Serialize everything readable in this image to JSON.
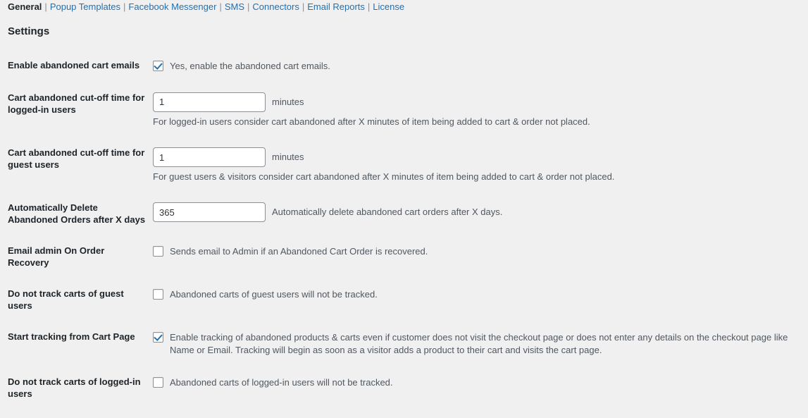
{
  "tabs": {
    "separator": "|",
    "items": [
      {
        "label": "General",
        "current": true
      },
      {
        "label": "Popup Templates",
        "current": false
      },
      {
        "label": "Facebook Messenger",
        "current": false
      },
      {
        "label": "SMS",
        "current": false
      },
      {
        "label": "Connectors",
        "current": false
      },
      {
        "label": "Email Reports",
        "current": false
      },
      {
        "label": "License",
        "current": false
      }
    ]
  },
  "heading": "Settings",
  "rows": [
    {
      "label": "Enable abandoned cart emails",
      "type": "checkbox",
      "checked": true,
      "checkbox_label": "Yes, enable the abandoned cart emails."
    },
    {
      "label": "Cart abandoned cut-off time for logged-in users",
      "type": "input",
      "value": "1",
      "unit": "minutes",
      "description": "For logged-in users consider cart abandoned after X minutes of item being added to cart & order not placed."
    },
    {
      "label": "Cart abandoned cut-off time for guest users",
      "type": "input",
      "value": "1",
      "unit": "minutes",
      "description": "For guest users & visitors consider cart abandoned after X minutes of item being added to cart & order not placed."
    },
    {
      "label": "Automatically Delete Abandoned Orders after X days",
      "type": "input-inline",
      "value": "365",
      "inline_description": "Automatically delete abandoned cart orders after X days."
    },
    {
      "label": "Email admin On Order Recovery",
      "type": "checkbox",
      "checked": false,
      "checkbox_label": "Sends email to Admin if an Abandoned Cart Order is recovered."
    },
    {
      "label": "Do not track carts of guest users",
      "type": "checkbox",
      "checked": false,
      "checkbox_label": "Abandoned carts of guest users will not be tracked."
    },
    {
      "label": "Start tracking from Cart Page",
      "type": "checkbox",
      "checked": true,
      "checkbox_label": "Enable tracking of abandoned products & carts even if customer does not visit the checkout page or does not enter any details on the checkout page like Name or Email. Tracking will begin as soon as a visitor adds a product to their cart and visits the cart page."
    },
    {
      "label": "Do not track carts of logged-in users",
      "type": "checkbox",
      "checked": false,
      "checkbox_label": "Abandoned carts of logged-in users will not be tracked."
    }
  ],
  "colors": {
    "background": "#f0f0f1",
    "link": "#2271b1",
    "label": "#1d2327",
    "text": "#50575e",
    "border": "#8c8f94",
    "checkmark": "#2271b1"
  }
}
